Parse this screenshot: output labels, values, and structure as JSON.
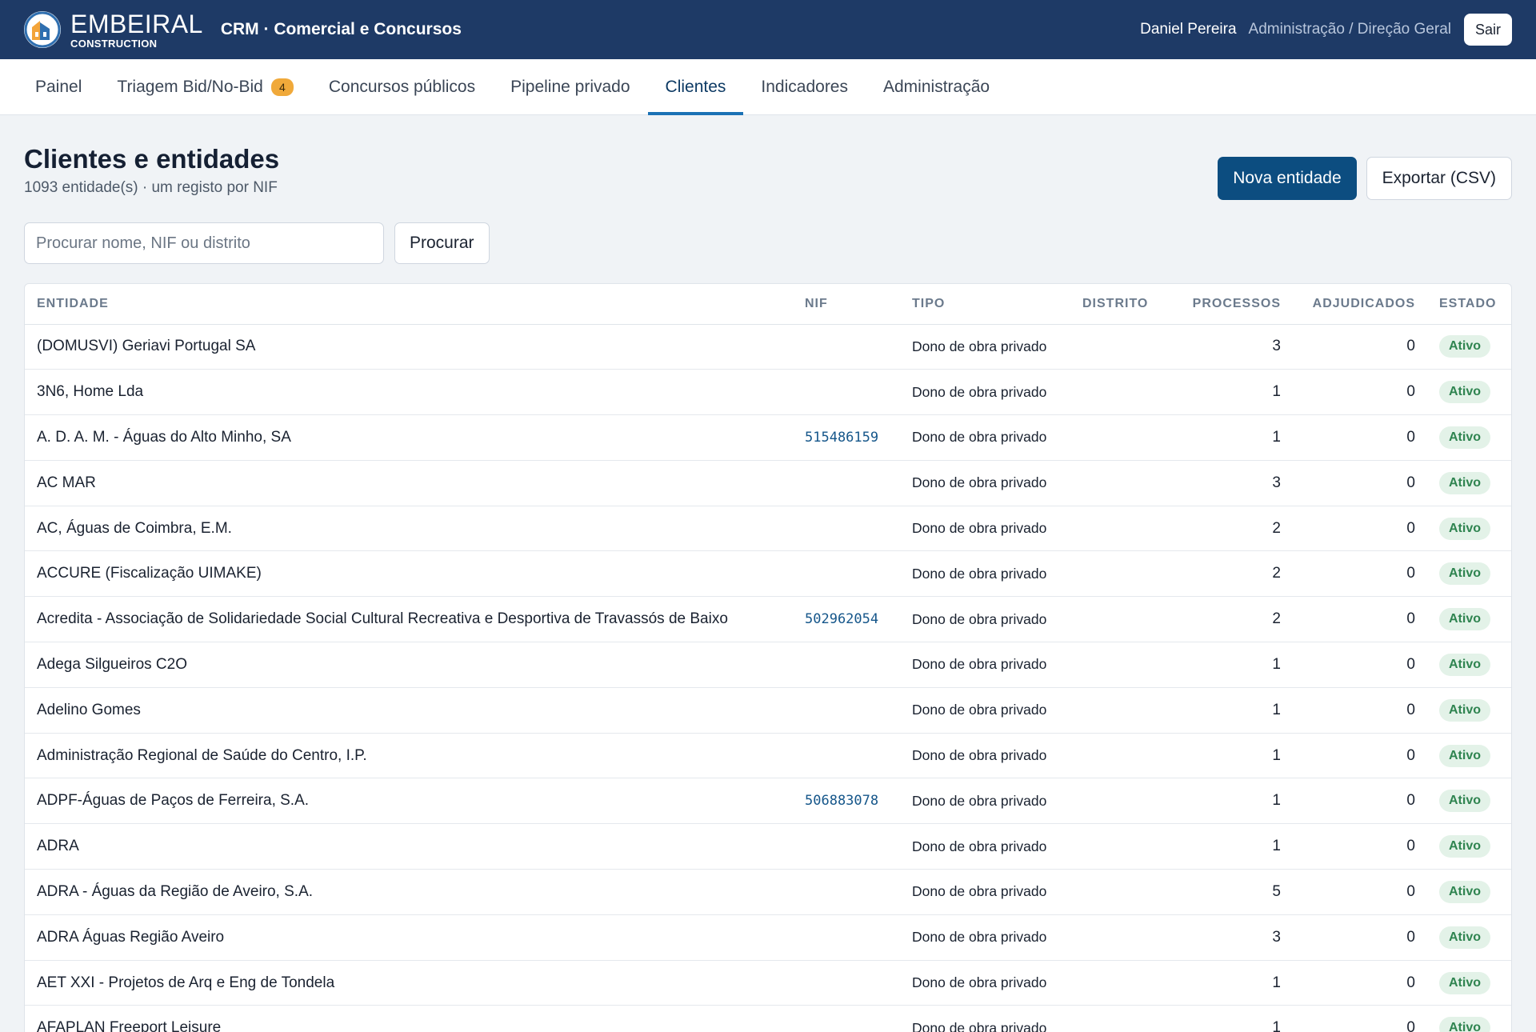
{
  "header": {
    "logo_main": "EMBEIRAL",
    "logo_sub": "CONSTRUCTION",
    "app_title": "CRM · Comercial e Concursos",
    "user_name": "Daniel Pereira",
    "user_role": "Administração / Direção Geral",
    "logout_label": "Sair"
  },
  "nav": {
    "items": [
      {
        "label": "Painel"
      },
      {
        "label": "Triagem Bid/No-Bid",
        "badge": "4"
      },
      {
        "label": "Concursos públicos"
      },
      {
        "label": "Pipeline privado"
      },
      {
        "label": "Clientes",
        "active": true
      },
      {
        "label": "Indicadores"
      },
      {
        "label": "Administração"
      }
    ]
  },
  "page": {
    "title": "Clientes e entidades",
    "subtitle": "1093 entidade(s) · um registo por NIF",
    "new_entity_label": "Nova entidade",
    "export_label": "Exportar (CSV)"
  },
  "search": {
    "placeholder": "Procurar nome, NIF ou distrito",
    "value": "",
    "button_label": "Procurar"
  },
  "table": {
    "columns": [
      "ENTIDADE",
      "NIF",
      "TIPO",
      "DISTRITO",
      "PROCESSOS",
      "ADJUDICADOS",
      "ESTADO"
    ],
    "rows": [
      {
        "entidade": "(DOMUSVI) Geriavi Portugal SA",
        "nif": "",
        "tipo": "Dono de obra privado",
        "distrito": "",
        "processos": "3",
        "adjudicados": "0",
        "estado": "Ativo"
      },
      {
        "entidade": "3N6, Home Lda",
        "nif": "",
        "tipo": "Dono de obra privado",
        "distrito": "",
        "processos": "1",
        "adjudicados": "0",
        "estado": "Ativo"
      },
      {
        "entidade": "A. D. A. M. - Águas do Alto Minho, SA",
        "nif": "515486159",
        "tipo": "Dono de obra privado",
        "distrito": "",
        "processos": "1",
        "adjudicados": "0",
        "estado": "Ativo"
      },
      {
        "entidade": "AC MAR",
        "nif": "",
        "tipo": "Dono de obra privado",
        "distrito": "",
        "processos": "3",
        "adjudicados": "0",
        "estado": "Ativo"
      },
      {
        "entidade": "AC, Águas de Coimbra, E.M.",
        "nif": "",
        "tipo": "Dono de obra privado",
        "distrito": "",
        "processos": "2",
        "adjudicados": "0",
        "estado": "Ativo"
      },
      {
        "entidade": "ACCURE (Fiscalização UIMAKE)",
        "nif": "",
        "tipo": "Dono de obra privado",
        "distrito": "",
        "processos": "2",
        "adjudicados": "0",
        "estado": "Ativo"
      },
      {
        "entidade": "Acredita - Associação de Solidariedade Social Cultural Recreativa e Desportiva de Travassós de Baixo",
        "nif": "502962054",
        "tipo": "Dono de obra privado",
        "distrito": "",
        "processos": "2",
        "adjudicados": "0",
        "estado": "Ativo"
      },
      {
        "entidade": "Adega Silgueiros C2O",
        "nif": "",
        "tipo": "Dono de obra privado",
        "distrito": "",
        "processos": "1",
        "adjudicados": "0",
        "estado": "Ativo"
      },
      {
        "entidade": "Adelino Gomes",
        "nif": "",
        "tipo": "Dono de obra privado",
        "distrito": "",
        "processos": "1",
        "adjudicados": "0",
        "estado": "Ativo"
      },
      {
        "entidade": "Administração Regional de Saúde do Centro, I.P.",
        "nif": "",
        "tipo": "Dono de obra privado",
        "distrito": "",
        "processos": "1",
        "adjudicados": "0",
        "estado": "Ativo"
      },
      {
        "entidade": "ADPF-Águas de Paços de Ferreira, S.A.",
        "nif": "506883078",
        "tipo": "Dono de obra privado",
        "distrito": "",
        "processos": "1",
        "adjudicados": "0",
        "estado": "Ativo"
      },
      {
        "entidade": "ADRA",
        "nif": "",
        "tipo": "Dono de obra privado",
        "distrito": "",
        "processos": "1",
        "adjudicados": "0",
        "estado": "Ativo"
      },
      {
        "entidade": "ADRA - Águas da Região de Aveiro, S.A.",
        "nif": "",
        "tipo": "Dono de obra privado",
        "distrito": "",
        "processos": "5",
        "adjudicados": "0",
        "estado": "Ativo"
      },
      {
        "entidade": "ADRA Águas Região Aveiro",
        "nif": "",
        "tipo": "Dono de obra privado",
        "distrito": "",
        "processos": "3",
        "adjudicados": "0",
        "estado": "Ativo"
      },
      {
        "entidade": "AET XXI - Projetos de Arq e Eng de Tondela",
        "nif": "",
        "tipo": "Dono de obra privado",
        "distrito": "",
        "processos": "1",
        "adjudicados": "0",
        "estado": "Ativo"
      },
      {
        "entidade": "AFAPLAN Freeport Leisure",
        "nif": "",
        "tipo": "Dono de obra privado",
        "distrito": "",
        "processos": "1",
        "adjudicados": "0",
        "estado": "Ativo"
      }
    ]
  },
  "colors": {
    "header_bg": "#1e3a66",
    "primary": "#0c4d80",
    "nav_active": "#1b72b5",
    "badge": "#f0a93a",
    "status_bg": "#e3f2e8",
    "status_text": "#2f8450"
  },
  "icons": {
    "logo": "embeiral-logo-icon"
  }
}
